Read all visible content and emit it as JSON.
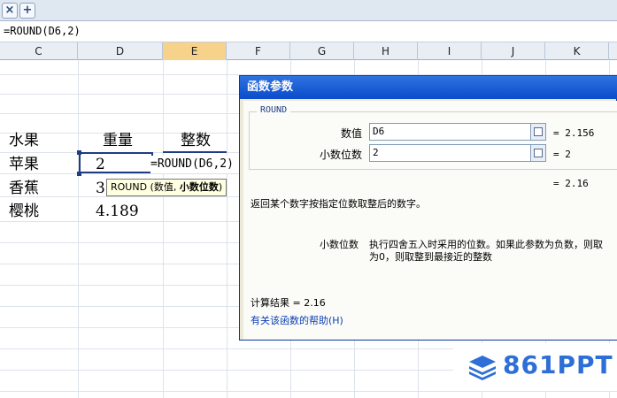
{
  "tabs": {
    "close_glyph": "×",
    "add_glyph": "+"
  },
  "formula_bar": {
    "text": "=ROUND(D6,2)"
  },
  "columns": [
    "C",
    "D",
    "E",
    "F",
    "G",
    "H",
    "I",
    "J",
    "K"
  ],
  "selected_column": "E",
  "cells": {
    "header_fruit": "水果",
    "header_weight": "重量",
    "header_integer": "整数",
    "row1_fruit": "苹果",
    "row1_weight": "2",
    "row2_fruit": "香蕉",
    "row2_weight": "3",
    "row3_fruit": "樱桃",
    "row3_weight": "4.189",
    "editing_formula": "=ROUND(D6,2)"
  },
  "tooltip": {
    "prefix": "ROUND (数值, ",
    "bold": "小数位数",
    "suffix": ")"
  },
  "dialog": {
    "title": "函数参数",
    "group_label": "ROUND",
    "arg1": {
      "label": "数值",
      "value": "D6",
      "result": "= 2.156"
    },
    "arg2": {
      "label": "小数位数",
      "value": "2",
      "result": "= 2"
    },
    "function_result": "= 2.16",
    "description": "返回某个数字按指定位数取整后的数字。",
    "param_name": "小数位数",
    "param_desc_line1": "执行四舍五入时采用的位数。如果此参数为负数，则取",
    "param_desc_line2": "为0，则取整到最接近的整数",
    "calc_result": "计算结果 = 2.16",
    "help_link": "有关该函数的帮助(H)"
  },
  "watermark": {
    "text": "861PPT"
  },
  "colors": {
    "accent": "#2d6fd6",
    "title_bar": "#0a4bcb",
    "selection_border": "#1f3c84"
  }
}
